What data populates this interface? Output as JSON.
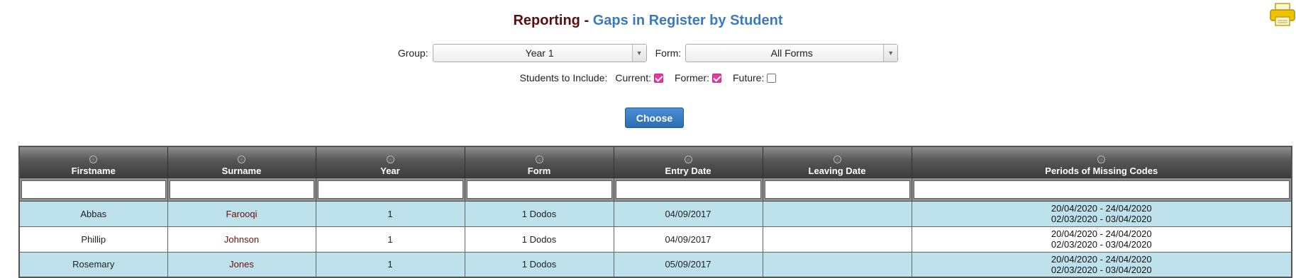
{
  "header": {
    "title_prefix": "Reporting",
    "separator": " - ",
    "title_suffix": "Gaps in Register by Student"
  },
  "filters": {
    "group_label": "Group:",
    "group_value": "Year 1",
    "form_label": "Form:",
    "form_value": "All Forms"
  },
  "include": {
    "label": "Students to Include:",
    "current_label": "Current:",
    "current_checked": true,
    "former_label": "Former:",
    "former_checked": true,
    "future_label": "Future:",
    "future_checked": false
  },
  "choose_label": "Choose",
  "table": {
    "columns": [
      "Firstname",
      "Surname",
      "Year",
      "Form",
      "Entry Date",
      "Leaving Date",
      "Periods of Missing Codes"
    ],
    "rows": [
      {
        "firstname": "Abbas",
        "surname": "Farooqi",
        "year": "1",
        "form": "1 Dodos",
        "entry": "04/09/2017",
        "leaving": "",
        "period1": "20/04/2020 - 24/04/2020",
        "period2": "02/03/2020 - 03/04/2020"
      },
      {
        "firstname": "Phillip",
        "surname": "Johnson",
        "year": "1",
        "form": "1 Dodos",
        "entry": "04/09/2017",
        "leaving": "",
        "period1": "20/04/2020 - 24/04/2020",
        "period2": "02/03/2020 - 03/04/2020"
      },
      {
        "firstname": "Rosemary",
        "surname": "Jones",
        "year": "1",
        "form": "1 Dodos",
        "entry": "05/09/2017",
        "leaving": "",
        "period1": "20/04/2020 - 24/04/2020",
        "period2": "02/03/2020 - 03/04/2020"
      }
    ]
  },
  "icons": {
    "printer": "printer-icon",
    "sort": "sort-icon",
    "dropdown": "chevron-down-icon"
  },
  "colors": {
    "title_prefix": "#5a0f0f",
    "title_suffix": "#3a7bbf",
    "checkbox_on": "#e23b9a",
    "row_highlight": "#bde2ec",
    "button": "#2d6db0"
  }
}
